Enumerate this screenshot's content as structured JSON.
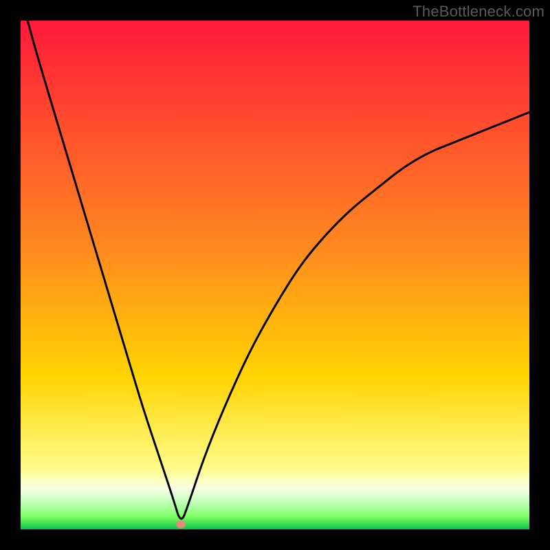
{
  "watermark": "TheBottleneck.com",
  "colors": {
    "frame": "#000000",
    "gradient_top": "#ff1a3a",
    "gradient_mid": "#ffd400",
    "green_band_top": "#f9ffe5",
    "green_band_mid": "#7dff65",
    "green_band_bottom": "#08c443",
    "curve": "#000000",
    "marker_fill": "#e48a7a"
  },
  "chart_data": {
    "type": "line",
    "title": "",
    "xlabel": "",
    "ylabel": "",
    "xlim": [
      0,
      100
    ],
    "ylim": [
      0,
      100
    ],
    "grid": false,
    "annotations": [
      {
        "text": "TheBottleneck.com",
        "position": "top-right"
      }
    ],
    "series": [
      {
        "name": "bottleneck-curve",
        "x": [
          0,
          3,
          6,
          9,
          12,
          15,
          18,
          21,
          24,
          27,
          30,
          31.5,
          33,
          36,
          40,
          45,
          50,
          55,
          60,
          65,
          70,
          75,
          80,
          85,
          90,
          95,
          100
        ],
        "y": [
          105,
          94,
          84,
          74,
          64,
          54,
          44,
          34,
          24,
          15,
          6,
          1,
          5,
          14,
          24,
          35,
          44,
          52,
          58,
          63,
          67,
          71,
          74,
          76,
          78,
          80,
          82
        ]
      }
    ],
    "markers": [
      {
        "name": "optimal-point",
        "x": 31.5,
        "y": 1
      }
    ]
  }
}
